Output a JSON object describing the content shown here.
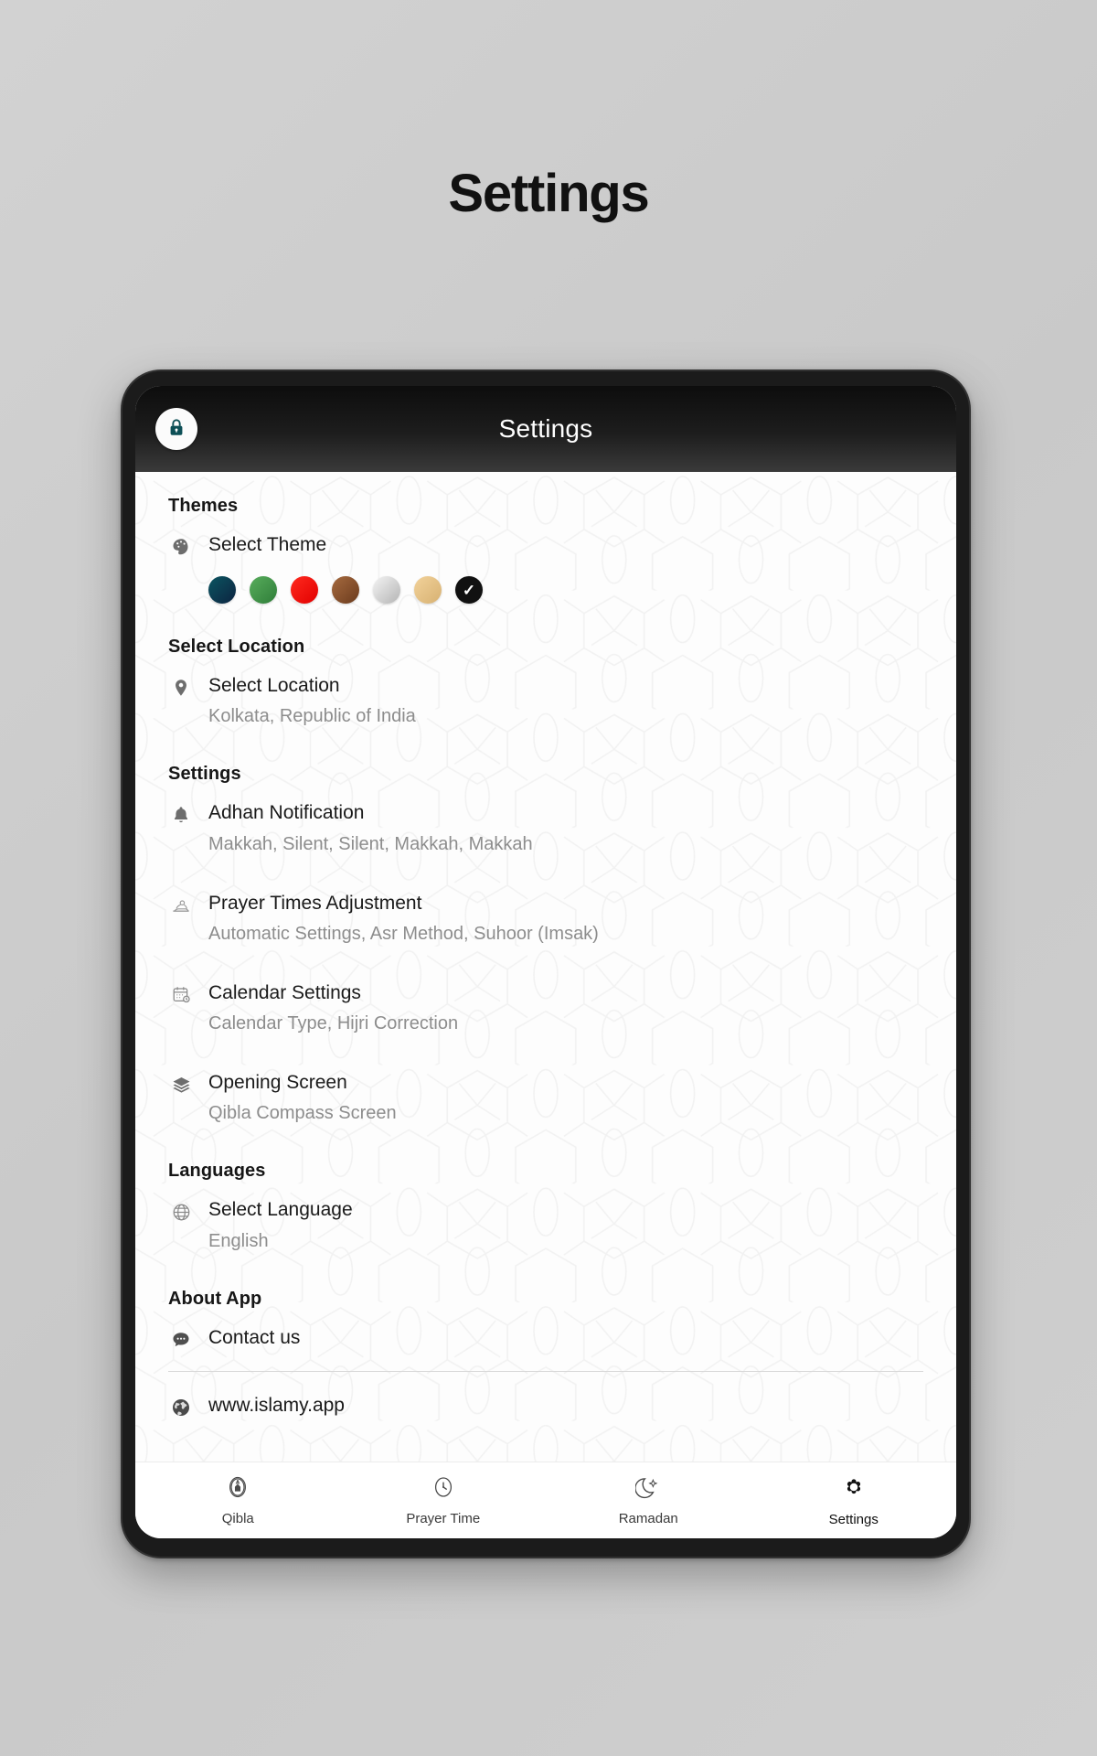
{
  "headline": "Settings",
  "device": {
    "appbar": {
      "title": "Settings",
      "lock_icon": "lock-icon",
      "lock_icon_color": "#0d4f56",
      "bg_top": "#0d0d0d",
      "bg_bottom": "#3a3a3a"
    },
    "sections": [
      {
        "id": "themes",
        "title": "Themes",
        "rows": [
          {
            "icon": "palette-icon",
            "label": "Select Theme",
            "sub": ""
          }
        ],
        "swatches": [
          {
            "name": "teal-navy",
            "color": "#0b5561",
            "color2": "#0c2340",
            "selected": false
          },
          {
            "name": "green",
            "color": "#4aa352",
            "color2": "#2f7d39",
            "selected": false
          },
          {
            "name": "red",
            "color": "#fb1313",
            "color2": "#e20000",
            "selected": false
          },
          {
            "name": "brown",
            "color": "#9c6239",
            "color2": "#6b3b1d",
            "selected": false
          },
          {
            "name": "silver",
            "color": "#f0f0f0",
            "color2": "#b9b9b9",
            "selected": false
          },
          {
            "name": "gold",
            "color": "#efcd92",
            "color2": "#d7b172",
            "selected": false
          },
          {
            "name": "black",
            "color": "#111111",
            "color2": "#000000",
            "selected": true
          }
        ]
      },
      {
        "id": "select-location",
        "title": "Select Location",
        "rows": [
          {
            "icon": "map-pin-icon",
            "label": "Select Location",
            "sub": "Kolkata, Republic of India"
          }
        ]
      },
      {
        "id": "settings",
        "title": "Settings",
        "rows": [
          {
            "icon": "bell-icon",
            "label": "Adhan Notification",
            "sub": "Makkah, Silent, Silent, Makkah, Makkah"
          },
          {
            "icon": "praying-icon",
            "label": "Prayer Times Adjustment",
            "sub": "Automatic Settings, Asr Method, Suhoor (Imsak)"
          },
          {
            "icon": "calendar-icon",
            "label": "Calendar Settings",
            "sub": "Calendar Type, Hijri Correction"
          },
          {
            "icon": "layers-icon",
            "label": "Opening Screen",
            "sub": "Qibla Compass Screen"
          }
        ]
      },
      {
        "id": "languages",
        "title": "Languages",
        "rows": [
          {
            "icon": "globe-grid-icon",
            "label": "Select Language",
            "sub": "English"
          }
        ]
      },
      {
        "id": "about-app",
        "title": "About App",
        "rows": [
          {
            "icon": "chat-bubble-icon",
            "label": "Contact us",
            "sub": ""
          },
          {
            "icon": "earth-icon",
            "label": "www.islamy.app",
            "sub": ""
          }
        ]
      }
    ],
    "bottom_nav": {
      "tabs": [
        {
          "icon": "kaaba-icon",
          "label": "Qibla",
          "active": false
        },
        {
          "icon": "clock-icon",
          "label": "Prayer Time",
          "active": false
        },
        {
          "icon": "moon-icon",
          "label": "Ramadan",
          "active": false
        },
        {
          "icon": "gear-icon",
          "label": "Settings",
          "active": true
        }
      ]
    }
  }
}
